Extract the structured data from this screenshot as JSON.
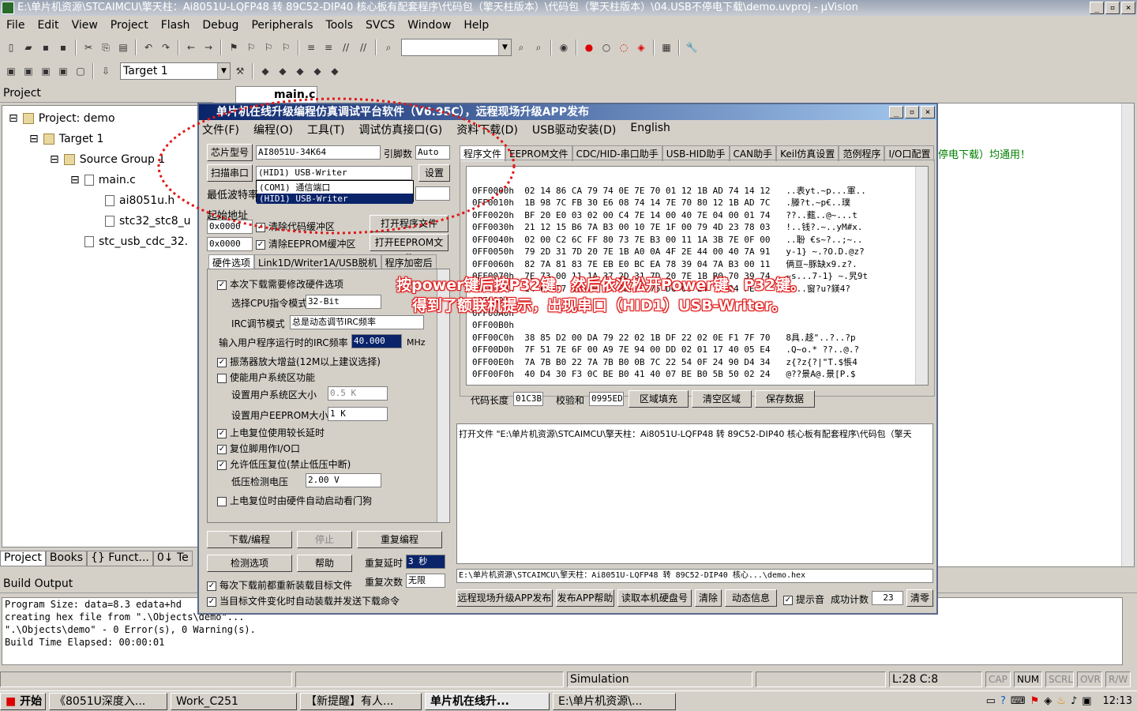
{
  "window": {
    "title": "E:\\单片机资源\\STCAIMCU\\擎天柱：Ai8051U-LQFP48 转 89C52-DIP40 核心板有配套程序\\代码包（擎天柱版本）\\代码包（擎天柱版本）\\04.USB不停电下载\\demo.uvproj - µVision"
  },
  "menu": [
    "File",
    "Edit",
    "View",
    "Project",
    "Flash",
    "Debug",
    "Peripherals",
    "Tools",
    "SVCS",
    "Window",
    "Help"
  ],
  "toolbar": {
    "target": "Target 1"
  },
  "project_panel": {
    "title": "Project",
    "tree": [
      "Project: demo",
      "Target 1",
      "Source Group 1",
      "main.c",
      "ai8051u.h",
      "stc32_stc8_u",
      "stc_usb_cdc_32."
    ],
    "tabs": [
      "Project",
      "Books",
      "{} Funct...",
      "0↓ Te"
    ]
  },
  "editor": {
    "tab": "main.c",
    "snippet": "停电下载）均通用！"
  },
  "build_output": {
    "title": "Build Output",
    "lines": [
      "Program Size: data=8.3 edata+hd",
      "creating hex file from \".\\Objects\\demo\"...",
      "\".\\Objects\\demo\" - 0 Error(s), 0 Warning(s).",
      "Build Time Elapsed:  00:00:01"
    ]
  },
  "dialog": {
    "title": "单片机在线升级编程仿真调试平台软件（V6.95C），远程现场升级APP发布",
    "menu": [
      "文件(F)",
      "编程(O)",
      "工具(T)",
      "调试仿真接口(G)",
      "资料下载(D)",
      "USB驱动安装(D)",
      "English"
    ],
    "chip_label": "芯片型号",
    "chip_value": "AI8051U-34K64",
    "pin_label": "引脚数",
    "pin_value": "Auto",
    "scan_label": "扫描串口",
    "port_value": "(HID1) USB-Writer",
    "settings_btn": "设置",
    "port_options": [
      "(COM1) 通信端口",
      "(HID1) USB-Writer"
    ],
    "baud_label": "最低波特率",
    "start_label": "起始地址",
    "addr1": "0x0000",
    "addr2": "0x0000",
    "clear_code": "清除代码缓冲区",
    "clear_eeprom": "清除EEPROM缓冲区",
    "open_prog": "打开程序文件",
    "open_eeprom": "打开EEPROM文件",
    "left_tabs": [
      "硬件选项",
      "Link1D/Writer1A/USB脱机",
      "程序加密后"
    ],
    "opt_modify": "本次下载需要修改硬件选项",
    "opt_cpu_label": "选择CPU指令模式",
    "opt_cpu_value": "32-Bit",
    "opt_irc_label": "IRC调节模式",
    "opt_irc_value": "总是动态调节IRC频率",
    "opt_freq_label": "输入用户程序运行时的IRC频率",
    "opt_freq_value": "40.000",
    "opt_freq_unit": "MHz",
    "opt_osc": "振荡器放大增益(12M以上建议选择)",
    "opt_sysarea": "使能用户系统区功能",
    "opt_sysarea_size_label": "设置用户系统区大小",
    "opt_sysarea_size": "0.5 K",
    "opt_eeprom_label": "设置用户EEPROM大小",
    "opt_eeprom_value": "1    K",
    "opt_reset_delay": "上电复位使用较长延时",
    "opt_reset_pin": "复位脚用作I/O口",
    "opt_lowvolt": "允许低压复位(禁止低压中断)",
    "opt_lowvolt_label": "低压检测电压",
    "opt_lowvolt_value": "2.00 V",
    "opt_watchdog": "上电复位时由硬件自动启动看门狗",
    "btn_download": "下载/编程",
    "btn_stop": "停止",
    "btn_reprog": "重复编程",
    "btn_check": "检测选项",
    "btn_help": "帮助",
    "repeat_delay_label": "重复延时",
    "repeat_delay_value": "3 秒",
    "repeat_count_label": "重复次数",
    "repeat_count_value": "无限",
    "chk_reload": "每次下载前都重新装载目标文件",
    "chk_auto": "当目标文件变化时自动装载并发送下载命令",
    "right_tabs": [
      "程序文件",
      "EEPROM文件",
      "CDC/HID-串口助手",
      "USB-HID助手",
      "CAN助手",
      "Keil仿真设置",
      "范例程序",
      "I/O口配置"
    ],
    "hex_lines": [
      "0FF0000h  02 14 86 CA 79 74 0E 7E 70 01 12 1B AD 74 14 12   ..表yt.~p...軍..",
      "0FF0010h  1B 98 7C FB 30 E6 08 74 14 7E 70 80 12 1B AD 7C   .滕?t.~p€..璞",
      "0FF0020h  BF 20 E0 03 02 00 C4 7E 14 00 40 7E 04 00 01 74   ??..薽..@~...t",
      "0FF0030h  21 12 15 B6 7A B3 00 10 7E 1F 00 79 4D 23 78 03   !..钱?.~..yM#x.",
      "0FF0040h  02 00 C2 6C FF 80 73 7E B3 00 11 1A 3B 7E 0F 00   ..聁 €s~?..;~..",
      "0FF0050h  79 2D 31 7D 20 7E 1B A0 0A 4F 2E 44 00 40 7A 91   y-1} ~.?O.D.@z?",
      "0FF0060h  82 7A 81 83 7E EB E0 BC EA 78 39 04 7A B3 00 11   俩亘~豚缺x9.z?.",
      "0FF0070h  7E 73 00 11 1A 37 2D 31 7D 20 7E 1B B0 70 39 74   ~s...7-1} ~.旯9t",
      "0FF0080h  14 6C 77 12 1B A7 0D 74 75 DC 00 E4 7E 34 FE     .lw..窗?u?鎂4?",
      "0FF0090h  ",
      "0FF00A0h  ",
      "0FF00B0h  ",
      "0FF00C0h  38 85 D2 00 DA 79 22 02 1B DF 22 02 0E F1 7F 70   8具.趍\"..?..?p",
      "0FF00D0h  7F 51 7E 6F 00 A9 7E 94 00 DD 02 01 17 40 05 E4   .Q~o.* ??..@.?",
      "0FF00E0h  7A 7B B0 22 7A 7B B0 0B 7C 22 54 0F 24 90 D4 34   z{?z{?|\"T.$悵4",
      "0FF00F0h  40 D4 30 F3 0C BE B0 41 40 07 BE B0 5B 50 02 24   @??景A@.景[P.$"
    ],
    "code_len_label": "代码长度",
    "code_len": "01C3B",
    "checksum_label": "校验和",
    "checksum": "0995ED",
    "btn_fill": "区域填充",
    "btn_clear_area": "清空区域",
    "btn_save": "保存数据",
    "log": "打开文件 \"E:\\单片机资源\\STCAIMCU\\擎天柱：Ai8051U-LQFP48 转 89C52-DIP40 核心板有配套程序\\代码包（擎天",
    "path": "E:\\单片机资源\\STCAIMCU\\擎天柱：Ai8051U-LQFP48 转 89C52-DIP40 核心...\\demo.hex",
    "btn_remote": "远程现场升级APP发布",
    "btn_publish_help": "发布APP帮助",
    "btn_read_disk": "读取本机硬盘号",
    "btn_clear": "清除",
    "btn_dynamic": "动态信息",
    "chk_prompt": "提示音",
    "success_label": "成功计数",
    "success_count": "23",
    "btn_clear_count": "清零"
  },
  "annotation": {
    "line1": "按power键后按P32键，然后依次松开Power键、P32键。",
    "line2": "得到了额联机提示，出现串口（HID1）USB-Writer。"
  },
  "statusbar": {
    "mode": "Simulation",
    "pos": "L:28 C:8",
    "indicators": [
      "CAP",
      "NUM",
      "SCRL",
      "OVR",
      "R/W"
    ]
  },
  "taskbar": {
    "start": "开始",
    "tasks": [
      "《8051U深度入...",
      "Work_C251",
      "【新提醒】有人...",
      "单片机在线升...",
      "E:\\单片机资源\\..."
    ],
    "time": "12:13"
  }
}
